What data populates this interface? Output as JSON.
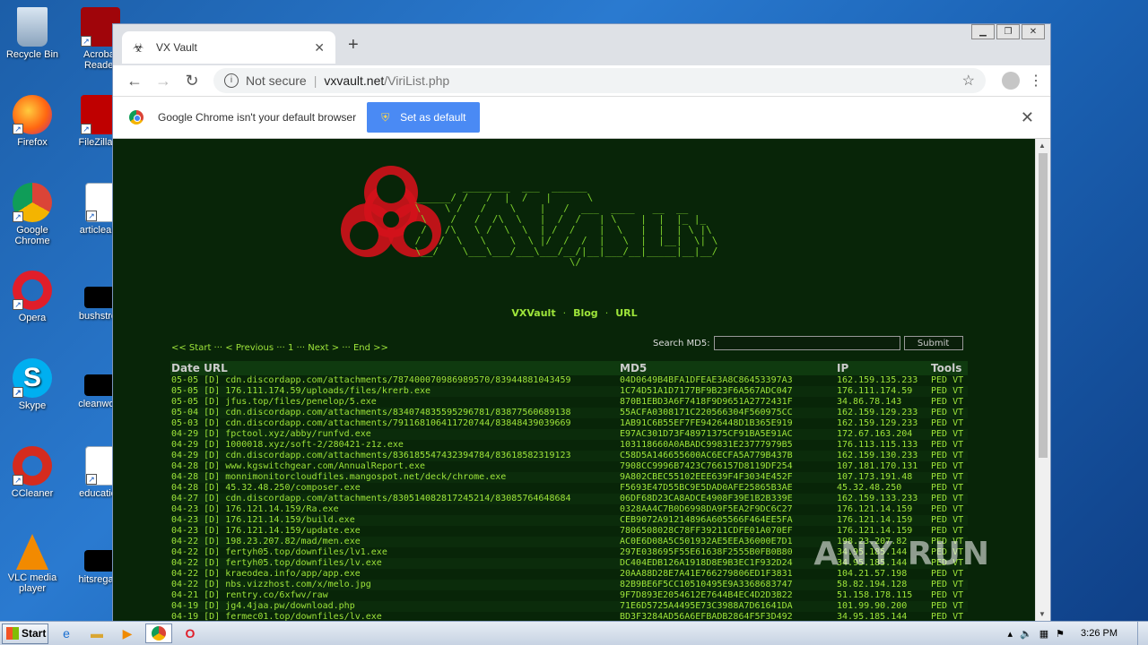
{
  "desktop": {
    "icons": [
      {
        "label": "Recycle Bin",
        "icon": "recycle-bin-icon"
      },
      {
        "label": "Acrobat Reader",
        "icon": "acrobat-icon"
      },
      {
        "label": "Firefox",
        "icon": "firefox-icon"
      },
      {
        "label": "FileZilla C",
        "icon": "filezilla-icon"
      },
      {
        "label": "Google Chrome",
        "icon": "chrome-icon"
      },
      {
        "label": "articleallo",
        "icon": "word-doc-icon"
      },
      {
        "label": "Opera",
        "icon": "opera-icon"
      },
      {
        "label": "bushstron",
        "icon": "blank-file-icon"
      },
      {
        "label": "Skype",
        "icon": "skype-icon"
      },
      {
        "label": "cleanwork",
        "icon": "blank-file-icon"
      },
      {
        "label": "CCleaner",
        "icon": "ccleaner-icon"
      },
      {
        "label": "education",
        "icon": "word-doc-icon"
      },
      {
        "label": "VLC media player",
        "icon": "vlc-icon"
      },
      {
        "label": "hitsregard",
        "icon": "blank-file-icon"
      }
    ]
  },
  "browser": {
    "tab_title": "VX Vault",
    "tab_close": "✕",
    "new_tab": "+",
    "not_secure": "Not secure",
    "url_host": "vxvault.net",
    "url_path": "/ViriList.php",
    "infobar_text": "Google Chrome isn't your default browser",
    "set_default_label": "Set as default"
  },
  "page": {
    "nav": {
      "vxvault": "VXVault",
      "blog": "Blog",
      "url": "URL"
    },
    "pager": "<< Start ··· < Previous ··· 1 ··· Next > ··· End >>",
    "search_label": "Search MD5:",
    "search_value": "",
    "submit_label": "Submit",
    "headers": {
      "date_url": "Date URL",
      "md5": "MD5",
      "ip": "IP",
      "tools": "Tools"
    },
    "rows": [
      {
        "date": "05-05",
        "url": "[D] cdn.discordapp.com/attachments/787400070986989570/83944881043459",
        "md5": "04D0649B4BFA1DFEAE3A8C86453397A3",
        "ip": "162.159.135.233",
        "tools": "PED VT"
      },
      {
        "date": "05-05",
        "url": "[D] 176.111.174.59/uploads/files/krerb.exe",
        "md5": "1C74D51A1D7177BF9B23F6A567ADC047",
        "ip": "176.111.174.59",
        "tools": "PED VT"
      },
      {
        "date": "05-05",
        "url": "[D] jfus.top/files/penelop/5.exe",
        "md5": "870B1EBD3A6F7418F9D9651A2772431F",
        "ip": "34.86.78.143",
        "tools": "PED VT"
      },
      {
        "date": "05-04",
        "url": "[D] cdn.discordapp.com/attachments/834074835595296781/83877560689138",
        "md5": "55ACFA0308171C220566304F560975CC",
        "ip": "162.159.129.233",
        "tools": "PED VT"
      },
      {
        "date": "05-03",
        "url": "[D] cdn.discordapp.com/attachments/791168106411720744/83848439039669",
        "md5": "1AB91C6B55EF7FE9426448D1B365E919",
        "ip": "162.159.129.233",
        "tools": "PED VT"
      },
      {
        "date": "04-29",
        "url": "[D] fpctool.xyz/abby/runfvd.exe",
        "md5": "E97AC301D73F48971375CF91BA5E91AC",
        "ip": "172.67.163.204",
        "tools": "PED VT"
      },
      {
        "date": "04-29",
        "url": "[D] 1000018.xyz/soft-2/280421-z1z.exe",
        "md5": "103118660A0ABADC99831E23777979B5",
        "ip": "176.113.115.133",
        "tools": "PED VT"
      },
      {
        "date": "04-29",
        "url": "[D] cdn.discordapp.com/attachments/836185547432394784/83618582319123",
        "md5": "C58D5A146655600AC6ECFA5A779B437B",
        "ip": "162.159.130.233",
        "tools": "PED VT"
      },
      {
        "date": "04-28",
        "url": "[D] www.kgswitchgear.com/AnnualReport.exe",
        "md5": "7908CC9996B7423C766157D8119DF254",
        "ip": "107.181.170.131",
        "tools": "PED VT"
      },
      {
        "date": "04-28",
        "url": "[D] monnimonitorcloudfiles.mangospot.net/deck/chrome.exe",
        "md5": "9A802CBEC55102EEE639F4F3034E452F",
        "ip": "107.173.191.48",
        "tools": "PED VT"
      },
      {
        "date": "04-28",
        "url": "[D] 45.32.48.250/composer.exe",
        "md5": "F5693E47D55BC9E5DAD0AFE25865B3AE",
        "ip": "45.32.48.250",
        "tools": "PED VT"
      },
      {
        "date": "04-27",
        "url": "[D] cdn.discordapp.com/attachments/830514082817245214/83085764648684",
        "md5": "06DF68D23CA8ADCE4908F39E1B2B339E",
        "ip": "162.159.133.233",
        "tools": "PED VT"
      },
      {
        "date": "04-23",
        "url": "[D] 176.121.14.159/Ra.exe",
        "md5": "0328AA4C7B0D6998DA9F5EA2F9DC6C27",
        "ip": "176.121.14.159",
        "tools": "PED VT"
      },
      {
        "date": "04-23",
        "url": "[D] 176.121.14.159/build.exe",
        "md5": "CEB9072A91214896A605566F464EE5FA",
        "ip": "176.121.14.159",
        "tools": "PED VT"
      },
      {
        "date": "04-23",
        "url": "[D] 176.121.14.159/update.exe",
        "md5": "7806508028C78FF39211CDFE01A070EF",
        "ip": "176.121.14.159",
        "tools": "PED VT"
      },
      {
        "date": "04-22",
        "url": "[D] 198.23.207.82/mad/men.exe",
        "md5": "AC0E6D08A5C501932AE5EEA36000E7D1",
        "ip": "198.23.207.82",
        "tools": "PED VT"
      },
      {
        "date": "04-22",
        "url": "[D] fertyh05.top/downfiles/lv1.exe",
        "md5": "297E038695F55E61638F2555B0FB0B80",
        "ip": "34.95.185.144",
        "tools": "PED VT"
      },
      {
        "date": "04-22",
        "url": "[D] fertyh05.top/downfiles/lv.exe",
        "md5": "DC404EDB126A1918D8E9B3EC1F932D24",
        "ip": "34.95.185.144",
        "tools": "PED VT"
      },
      {
        "date": "04-22",
        "url": "[D] kraeodea.info/app/app.exe",
        "md5": "20AA88D28E7A41E766279806ED1F3831",
        "ip": "104.21.57.198",
        "tools": "PED VT"
      },
      {
        "date": "04-22",
        "url": "[D] nbs.vizzhost.com/x/melo.jpg",
        "md5": "82B9BE6F5CC10510495E9A3368683747",
        "ip": "58.82.194.128",
        "tools": "PED VT"
      },
      {
        "date": "04-21",
        "url": "[D] rentry.co/6xfwv/raw",
        "md5": "9F7D893E2054612E7644B4EC4D2D3B22",
        "ip": "51.158.178.115",
        "tools": "PED VT"
      },
      {
        "date": "04-19",
        "url": "[D] jg4.4jaa.pw/download.php",
        "md5": "71E6D5725A4495E73C3988A7D61641DA",
        "ip": "101.99.90.200",
        "tools": "PED VT"
      },
      {
        "date": "04-19",
        "url": "[D] fermec01.top/downfiles/lv.exe",
        "md5": "BD3F3284AD56A6EFBADB2864F5F3D492",
        "ip": "34.95.185.144",
        "tools": "PED VT"
      }
    ]
  },
  "watermark": "ANY RUN",
  "taskbar": {
    "start_label": "Start",
    "clock": "3:26 PM"
  }
}
